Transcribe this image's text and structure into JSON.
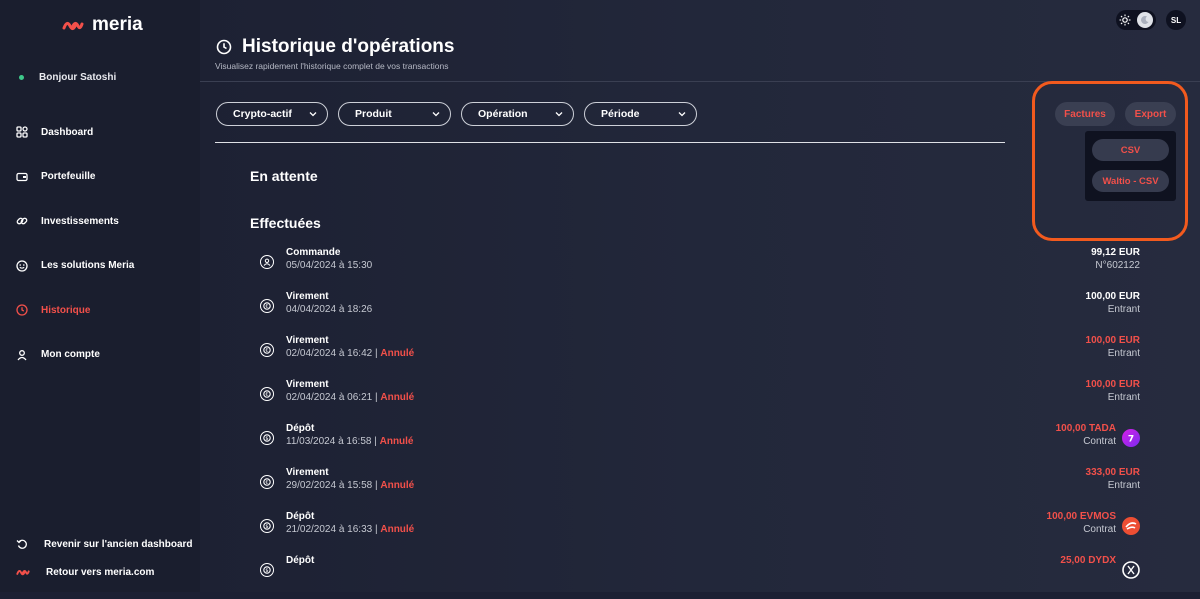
{
  "app": {
    "logo_text": "meria"
  },
  "sidebar": {
    "greeting": "Bonjour Satoshi",
    "items": [
      {
        "label": "Dashboard",
        "icon": "grid-icon"
      },
      {
        "label": "Portefeuille",
        "icon": "wallet-icon"
      },
      {
        "label": "Investissements",
        "icon": "link-icon"
      },
      {
        "label": "Les solutions Meria",
        "icon": "smile-icon"
      },
      {
        "label": "Historique",
        "icon": "clock-icon",
        "active": true
      },
      {
        "label": "Mon compte",
        "icon": "user-icon"
      }
    ],
    "bottom": {
      "old_dashboard": "Revenir sur l'ancien dashboard",
      "back_site": "Retour vers meria.com"
    }
  },
  "header": {
    "title": "Historique d'opérations",
    "subtitle": "Visualisez rapidement l'historique complet de vos transactions",
    "avatar": "SL"
  },
  "filters": [
    "Crypto-actif",
    "Produit",
    "Opération",
    "Période"
  ],
  "actions": {
    "factures": "Factures",
    "export": "Export",
    "export_menu": [
      "CSV",
      "Waltio - CSV"
    ]
  },
  "sections": {
    "pending": "En attente",
    "done": "Effectuées"
  },
  "transactions": [
    {
      "name": "Commande",
      "date": "05/04/2024 à 15:30",
      "status": "",
      "amount": "99,12 EUR",
      "sub": "N°602122",
      "amount_color": "white",
      "icon": "user-circle-icon"
    },
    {
      "name": "Virement",
      "date": "04/04/2024 à 18:26",
      "status": "",
      "amount": "100,00 EUR",
      "sub": "Entrant",
      "amount_color": "white",
      "icon": "euro-icon"
    },
    {
      "name": "Virement",
      "date": "02/04/2024 à 16:42",
      "status": "Annulé",
      "amount": "100,00 EUR",
      "sub": "Entrant",
      "amount_color": "red",
      "icon": "euro-icon"
    },
    {
      "name": "Virement",
      "date": "02/04/2024 à 06:21",
      "status": "Annulé",
      "amount": "100,00 EUR",
      "sub": "Entrant",
      "amount_color": "red",
      "icon": "euro-icon"
    },
    {
      "name": "Dépôt",
      "date": "11/03/2024 à 16:58",
      "status": "Annulé",
      "amount": "100,00 TADA",
      "sub": "Contrat",
      "amount_color": "red",
      "icon": "coin-icon",
      "coin": "tada-icon"
    },
    {
      "name": "Virement",
      "date": "29/02/2024 à 15:58",
      "status": "Annulé",
      "amount": "333,00 EUR",
      "sub": "Entrant",
      "amount_color": "red",
      "icon": "euro-icon"
    },
    {
      "name": "Dépôt",
      "date": "21/02/2024 à 16:33",
      "status": "Annulé",
      "amount": "100,00 EVMOS",
      "sub": "Contrat",
      "amount_color": "red",
      "icon": "coin-icon",
      "coin": "evmos-icon"
    },
    {
      "name": "Dépôt",
      "date": "",
      "status": "",
      "amount": "25,00 DYDX",
      "sub": "",
      "amount_color": "red",
      "icon": "coin-icon",
      "coin": "dydx-icon"
    }
  ],
  "colors": {
    "accent": "#f2504a",
    "highlight": "#f25a1e",
    "background": "#1c2033"
  }
}
